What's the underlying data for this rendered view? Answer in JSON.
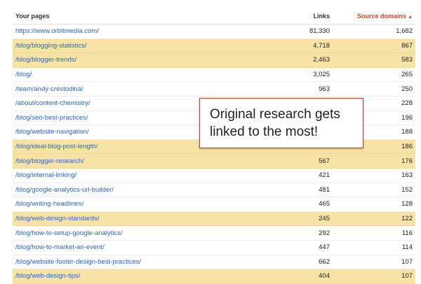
{
  "table": {
    "headers": {
      "page": "Your pages",
      "links": "Links",
      "domains": "Source domains",
      "sort_icon": "caret-up-icon"
    },
    "rows": [
      {
        "page": "https://www.orbitmedia.com/",
        "links": "81,330",
        "domains": "1,682",
        "highlighted": false
      },
      {
        "page": "/blog/blogging-statistics/",
        "links": "4,718",
        "domains": "867",
        "highlighted": true
      },
      {
        "page": "/blog/blogger-trends/",
        "links": "2,463",
        "domains": "583",
        "highlighted": true
      },
      {
        "page": "/blog/",
        "links": "3,025",
        "domains": "265",
        "highlighted": false
      },
      {
        "page": "/team/andy-crestodina/",
        "links": "963",
        "domains": "250",
        "highlighted": false
      },
      {
        "page": "/about/content-chemistry/",
        "links": "",
        "domains": "228",
        "highlighted": false
      },
      {
        "page": "/blog/seo-best-practices/",
        "links": "",
        "domains": "196",
        "highlighted": false
      },
      {
        "page": "/blog/website-navigation/",
        "links": "",
        "domains": "188",
        "highlighted": false
      },
      {
        "page": "/blog/ideal-blog-post-length/",
        "links": "",
        "domains": "186",
        "highlighted": true
      },
      {
        "page": "/blog/blogger-research/",
        "links": "567",
        "domains": "176",
        "highlighted": true
      },
      {
        "page": "/blog/internal-linking/",
        "links": "421",
        "domains": "163",
        "highlighted": false
      },
      {
        "page": "/blog/google-analytics-url-builder/",
        "links": "481",
        "domains": "152",
        "highlighted": false
      },
      {
        "page": "/blog/writing-headlines/",
        "links": "465",
        "domains": "128",
        "highlighted": false
      },
      {
        "page": "/blog/web-design-standards/",
        "links": "245",
        "domains": "122",
        "highlighted": true
      },
      {
        "page": "/blog/how-to-setup-google-analytics/",
        "links": "292",
        "domains": "116",
        "highlighted": false
      },
      {
        "page": "/blog/how-to-market-an-event/",
        "links": "447",
        "domains": "114",
        "highlighted": false
      },
      {
        "page": "/blog/website-footer-design-best-practices/",
        "links": "662",
        "domains": "107",
        "highlighted": false
      },
      {
        "page": "/blog/web-design-tips/",
        "links": "404",
        "domains": "107",
        "highlighted": true
      }
    ]
  },
  "callout": {
    "line1": "Original research gets",
    "line2": "linked to the most!"
  },
  "colors": {
    "highlight": "#f8e3a6",
    "link": "#2a66c8",
    "sorted_header": "#d9412f",
    "callout_border": "#c0392b"
  }
}
